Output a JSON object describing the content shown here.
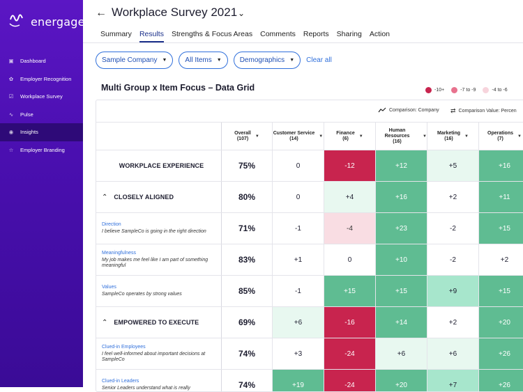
{
  "brand": {
    "logo_text": "energage"
  },
  "sidebar": {
    "items": [
      {
        "label": "Dashboard",
        "icon": "dashboard-icon"
      },
      {
        "label": "Employer Recognition",
        "icon": "ribbon-icon"
      },
      {
        "label": "Workplace Survey",
        "icon": "clipboard-icon"
      },
      {
        "label": "Pulse",
        "icon": "pulse-icon"
      },
      {
        "label": "Insights",
        "icon": "insights-icon",
        "active": true
      },
      {
        "label": "Employer Branding",
        "icon": "star-icon"
      }
    ]
  },
  "header": {
    "title": "Workplace Survey 2021",
    "tabs": [
      "Summary",
      "Results",
      "Strengths & Focus Areas",
      "Comments",
      "Reports",
      "Sharing",
      "Action"
    ],
    "active_tab": "Results"
  },
  "filters": {
    "company": "Sample Company",
    "items": "All Items",
    "demographics": "Demographics",
    "clear": "Clear all"
  },
  "grid": {
    "title": "Multi Group x Item Focus – Data Grid",
    "legend": [
      {
        "label": "-10+",
        "color": "#c8244e"
      },
      {
        "label": "-7 to -9",
        "color": "#e8728e"
      },
      {
        "label": "-4 to -6",
        "color": "#f7d4dc"
      }
    ],
    "comparison_company": "Comparison: Company",
    "comparison_value": "Comparison Value: Percen",
    "columns": [
      {
        "name": "Overall",
        "count": "(107)"
      },
      {
        "name": "Customer Service",
        "count": "(14)"
      },
      {
        "name": "Finance",
        "count": "(6)"
      },
      {
        "name": "Human Resources",
        "count": "(16)"
      },
      {
        "name": "Marketing",
        "count": "(16)"
      },
      {
        "name": "Operations",
        "count": "(7)"
      }
    ],
    "rows": [
      {
        "type": "section",
        "label": "WORKPLACE EXPERIENCE",
        "overall": "75%",
        "values": [
          "0",
          "-12",
          "+12",
          "+5",
          "+16"
        ]
      },
      {
        "type": "group",
        "label": "CLOSELY ALIGNED",
        "overall": "80%",
        "values": [
          "0",
          "+4",
          "+16",
          "+2",
          "+11"
        ]
      },
      {
        "type": "item",
        "label": "Direction",
        "desc": "I believe SampleCo is going in the right direction",
        "overall": "71%",
        "values": [
          "-1",
          "-4",
          "+23",
          "-2",
          "+15"
        ]
      },
      {
        "type": "item",
        "label": "Meaningfulness",
        "desc": "My job makes me feel like I am part of something meaningful",
        "overall": "83%",
        "values": [
          "+1",
          "0",
          "+10",
          "-2",
          "+2"
        ]
      },
      {
        "type": "item",
        "label": "Values",
        "desc": "SampleCo operates by strong values",
        "overall": "85%",
        "values": [
          "-1",
          "+15",
          "+15",
          "+9",
          "+15"
        ]
      },
      {
        "type": "group",
        "label": "EMPOWERED TO EXECUTE",
        "overall": "69%",
        "values": [
          "+6",
          "-16",
          "+14",
          "+2",
          "+20"
        ]
      },
      {
        "type": "item",
        "label": "Clued-in Employees",
        "desc": "I feel well-informed about important decisions at SampleCo",
        "overall": "74%",
        "values": [
          "+3",
          "-24",
          "+6",
          "+6",
          "+26"
        ]
      },
      {
        "type": "item",
        "label": "Clued-in Leaders",
        "desc": "Senior Leaders understand what is really",
        "overall": "74%",
        "values": [
          "+19",
          "-24",
          "+20",
          "+7",
          "+26"
        ]
      }
    ]
  },
  "colors": {
    "dark_red": "#c8244e",
    "mid_red": "#e8728e",
    "light_red": "#f9dde3",
    "dark_green": "#5fbc92",
    "mid_green": "#a7e6cc",
    "light_green": "#e8f8f0"
  }
}
